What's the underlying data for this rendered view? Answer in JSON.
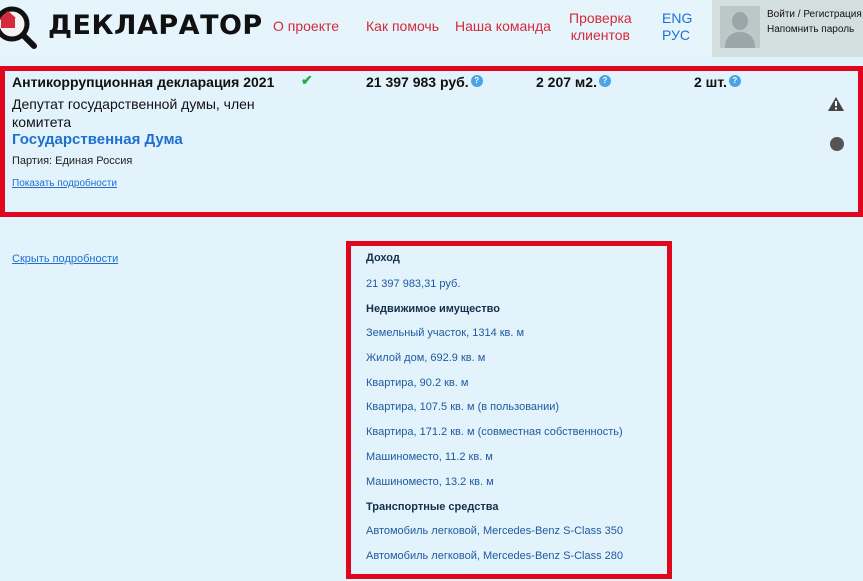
{
  "header": {
    "logo_text": "ДЕКЛАРАТОР",
    "nav": [
      {
        "label": "О проекте"
      },
      {
        "label": "Как помочь"
      },
      {
        "label": "Наша команда"
      },
      {
        "label_line1": "Проверка",
        "label_line2": "клиентов"
      }
    ],
    "lang": [
      "ENG",
      "РУС"
    ],
    "user": {
      "login_label": "Войти / Регистрация",
      "remind_label": "Напомнить пароль"
    }
  },
  "declaration": {
    "title": "Антикоррупционная декларация 2021",
    "verified_mark": "✔",
    "income": "21 397 983 руб.",
    "area": "2 207 м2.",
    "vehicles": "2 шт.",
    "position": "Депутат государственной думы, член комитета",
    "organization": "Государственная Дума",
    "party": "Партия: Единая Россия",
    "show_details": "Показать подробности",
    "hide_details": "Скрыть подробности"
  },
  "details": {
    "income_heading": "Доход",
    "income_value": "21 397 983,31 руб.",
    "realty_heading": "Недвижимое имущество",
    "realty": [
      "Земельный участок, 1314 кв. м",
      "Жилой дом, 692.9 кв. м",
      "Квартира, 90.2 кв. м",
      "Квартира, 107.5 кв. м (в пользовании)",
      "Квартира, 171.2 кв. м (совместная собственность)",
      "Машиноместо, 11.2 кв. м",
      "Машиноместо, 13.2 кв. м"
    ],
    "vehicles_heading": "Транспортные средства",
    "vehicles": [
      "Автомобиль легковой, Mercedes-Benz S-Class 350",
      "Автомобиль легковой, Mercedes-Benz S-Class 280"
    ]
  },
  "colors": {
    "highlight": "#e0061d",
    "link": "#1f6fd0",
    "nav": "#d42a3a",
    "background": "#e3f3fb"
  }
}
